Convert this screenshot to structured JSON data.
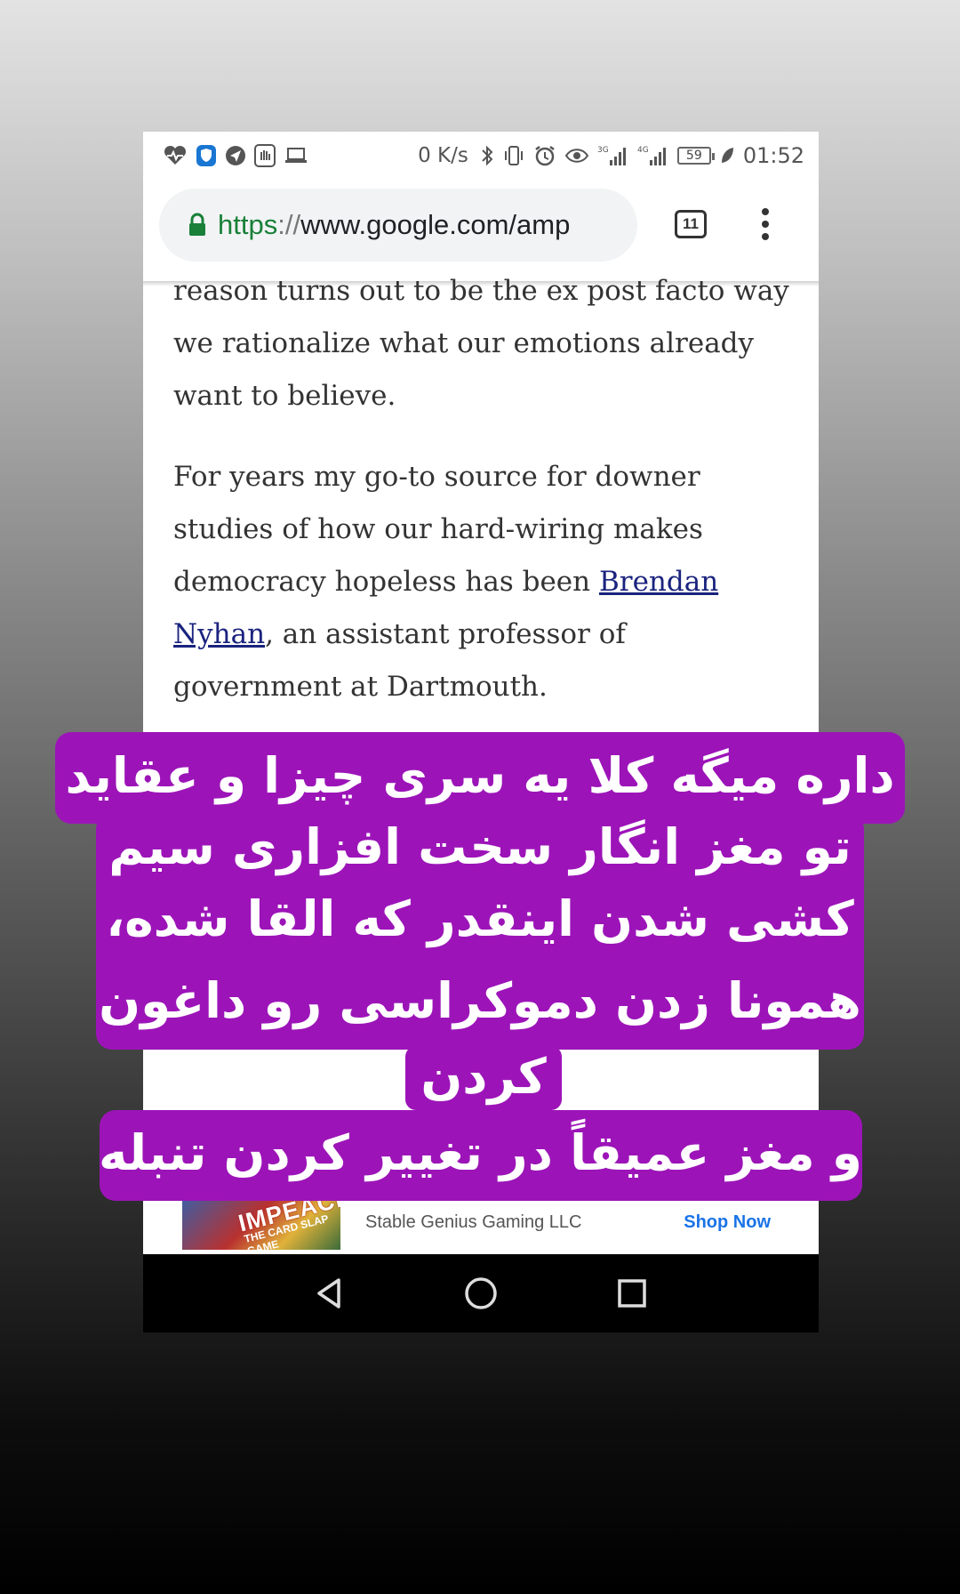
{
  "status_bar": {
    "network_speed": "0 K/s",
    "signal_3g_label": "3G",
    "signal_4g_label": "4G",
    "battery_level": "59",
    "time": "01:52",
    "left_icons": [
      "heart-rate-icon",
      "shield-icon",
      "send-icon",
      "hand-icon",
      "laptop-icon"
    ],
    "right_icons": [
      "bluetooth-icon",
      "vibrate-icon",
      "alarm-icon",
      "eye-icon",
      "signal-icon",
      "signal-icon",
      "battery-icon",
      "leaf-icon"
    ]
  },
  "browser": {
    "url_scheme": "https",
    "url_separator": "://",
    "url_host": "www.google.com/amp",
    "tab_count": "11"
  },
  "article": {
    "para1": "reason turns out to be the ex post facto way we rationalize what our emotions already want to believe.",
    "para2_before": "For years my go-to source for downer studies of how our hard-wiring makes democracy hopeless has been ",
    "para2_link": "Brendan Nyhan",
    "para2_after": ", an assistant professor of government at Dartmouth."
  },
  "ad": {
    "thumb_title": "IMPEACH",
    "thumb_subtitle": "THE CARD SLAP GAME",
    "seller": "Stable Genius Gaming LLC",
    "cta": "Shop Now"
  },
  "overlay": {
    "line1": "داره میگه کلا یه سری چیزا و عقاید",
    "line2": "تو مغز انگار سخت افزاری سیم",
    "line3": "کشی شدن اینقدر که القا شده،",
    "line4": "همونا زدن دموکراسی رو داغون",
    "line5": "کردن",
    "line6": "و مغز عمیقاً در تغییر کردن تنبله"
  },
  "colors": {
    "caption_bg": "#9c14b8",
    "link": "#1a237e",
    "url_scheme": "#188038",
    "ad_cta": "#1a73e8"
  }
}
